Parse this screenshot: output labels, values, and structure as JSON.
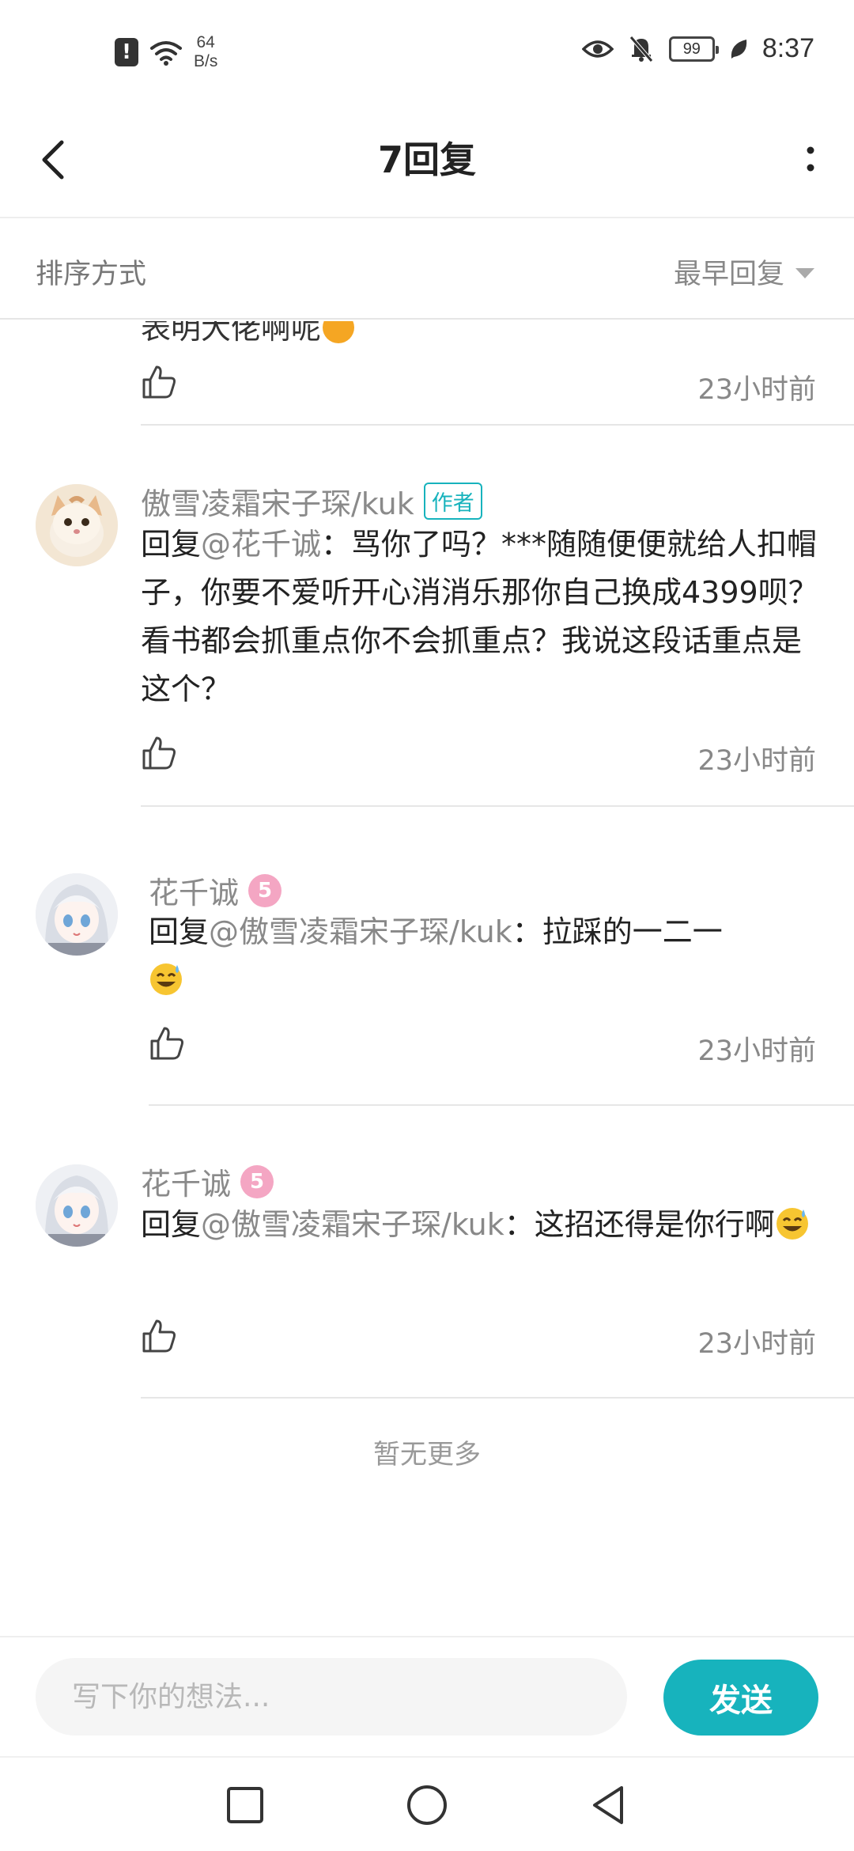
{
  "status_bar": {
    "net_speed_value": "64",
    "net_speed_unit": "B/s",
    "battery": "99",
    "time": "8:37"
  },
  "nav": {
    "title": "7回复"
  },
  "sort": {
    "label": "排序方式",
    "value": "最早回复"
  },
  "comments": {
    "partial": {
      "text": "表明大佬啊呢",
      "time": "23小时前"
    },
    "items": [
      {
        "author": "傲雪凌霜宋子琛/kuk",
        "tag": "作者",
        "reply_prefix": "回复",
        "mention": "@花千诚",
        "text": "：骂你了吗？***随随便便就给人扣帽子，你要不爱听开心消消乐那你自己换成4399呗？看书都会抓重点你不会抓重点？我说这段话重点是这个？",
        "time": "23小时前"
      },
      {
        "author": "花千诚",
        "level": "5",
        "reply_prefix": "回复",
        "mention": "@傲雪凌霜宋子琛/kuk",
        "text": "：拉踩的一二一",
        "time": "23小时前"
      },
      {
        "author": "花千诚",
        "level": "5",
        "reply_prefix": "回复",
        "mention": "@傲雪凌霜宋子琛/kuk",
        "text": "：这招还得是你行啊",
        "time": "23小时前"
      }
    ],
    "no_more": "暂无更多"
  },
  "input": {
    "placeholder": "写下你的想法...",
    "send_label": "发送"
  },
  "colors": {
    "accent": "#17b3bd",
    "level_badge": "#f4a6c3"
  }
}
